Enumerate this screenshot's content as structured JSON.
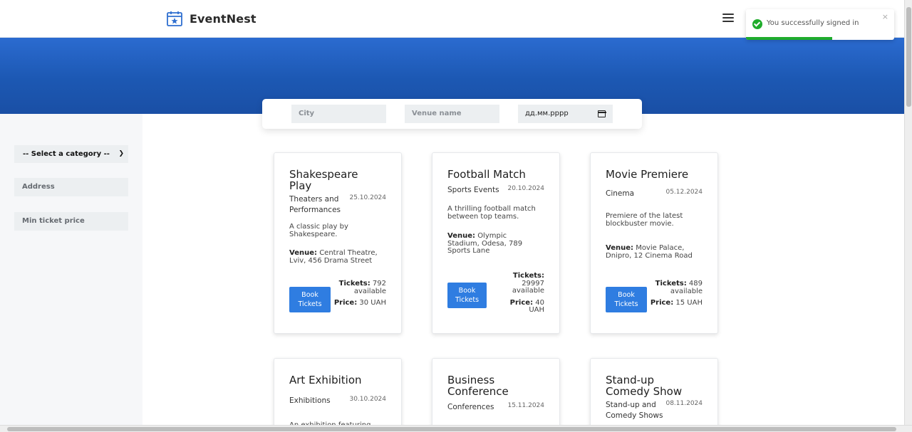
{
  "brand": {
    "name": "EventNest",
    "icon": "calendar-star-icon"
  },
  "header": {
    "menu_icon": "hamburger-icon"
  },
  "search": {
    "city_placeholder": "City",
    "venue_placeholder": "Venue name",
    "date_placeholder": "дд.мм.рррр"
  },
  "filters": {
    "category_selected": "-- Select a category --",
    "address_placeholder": "Address",
    "min_price_placeholder": "Min ticket price"
  },
  "events": [
    {
      "title": "Shakespeare Play",
      "category": "Theaters and Performances",
      "date": "25.10.2024",
      "description": "A classic play by Shakespeare.",
      "venue_label": "Venue:",
      "venue": "Central Theatre, Lviv, 456 Drama Street",
      "book_label": "Book Tickets",
      "tickets_label": "Tickets:",
      "tickets": "792 available",
      "price_label": "Price:",
      "price": "30 UAH"
    },
    {
      "title": "Football Match",
      "category": "Sports Events",
      "date": "20.10.2024",
      "description": "A thrilling football match between top teams.",
      "venue_label": "Venue:",
      "venue": "Olympic Stadium, Odesa, 789 Sports Lane",
      "book_label": "Book Tickets",
      "tickets_label": "Tickets:",
      "tickets": "29997 available",
      "price_label": "Price:",
      "price": "40 UAH"
    },
    {
      "title": "Movie Premiere",
      "category": "Cinema",
      "date": "05.12.2024",
      "description": "Premiere of the latest blockbuster movie.",
      "venue_label": "Venue:",
      "venue": "Movie Palace, Dnipro, 12 Cinema Road",
      "book_label": "Book Tickets",
      "tickets_label": "Tickets:",
      "tickets": "489 available",
      "price_label": "Price:",
      "price": "15 UAH"
    },
    {
      "title": "Art Exhibition",
      "category": "Exhibitions",
      "date": "30.10.2024",
      "description": "An exhibition featuring"
    },
    {
      "title": "Business Conference",
      "category": "Conferences",
      "date": "15.11.2024"
    },
    {
      "title": "Stand-up Comedy Show",
      "category": "Stand-up and Comedy Shows",
      "date": "08.11.2024"
    }
  ],
  "toast": {
    "message": "You successfully signed in!",
    "close": "×",
    "progress": 0.58,
    "color": "#1fac2b"
  },
  "colors": {
    "hero": "#1c58b3",
    "button": "#2f7de1"
  }
}
